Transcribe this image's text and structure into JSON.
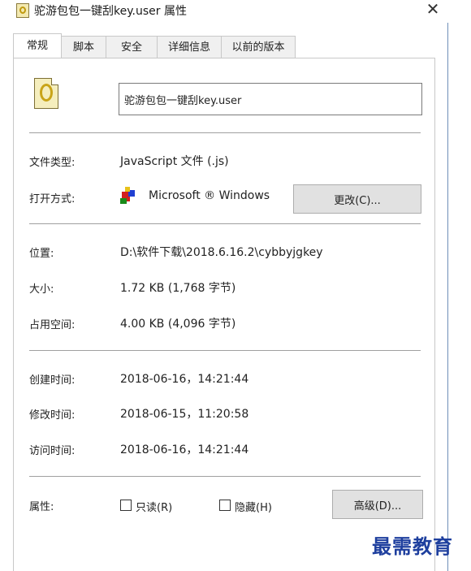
{
  "window": {
    "title": "驼游包包一键刮key.user 属性",
    "close_glyph": "✕"
  },
  "tabs": [
    {
      "label": "常规",
      "active": true
    },
    {
      "label": "脚本",
      "active": false
    },
    {
      "label": "安全",
      "active": false
    },
    {
      "label": "详细信息",
      "active": false
    },
    {
      "label": "以前的版本",
      "active": false
    }
  ],
  "general": {
    "file_name": "驼游包包一键刮key.user",
    "file_type_label": "文件类型:",
    "file_type_value": "JavaScript 文件 (.js)",
    "open_with_label": "打开方式:",
    "open_with_value": "Microsoft ® Windows",
    "change_button": "更改(C)...",
    "location_label": "位置:",
    "location_value": "D:\\软件下载\\2018.6.16.2\\cybbyjgkey",
    "size_label": "大小:",
    "size_value": "1.72 KB (1,768 字节)",
    "disk_size_label": "占用空间:",
    "disk_size_value": "4.00 KB (4,096 字节)",
    "created_label": "创建时间:",
    "created_value": "2018-06-16，14:21:44",
    "modified_label": "修改时间:",
    "modified_value": "2018-06-15，11:20:58",
    "accessed_label": "访问时间:",
    "accessed_value": "2018-06-16，14:21:44",
    "attributes_label": "属性:",
    "readonly_label": "只读(R)",
    "readonly_checked": false,
    "hidden_label": "隐藏(H)",
    "hidden_checked": false,
    "advanced_button": "高级(D)..."
  },
  "watermark": "最需教育",
  "icons": {
    "file_icon": "javascript-file-icon",
    "app_icon": "windows-script-host-icon"
  }
}
